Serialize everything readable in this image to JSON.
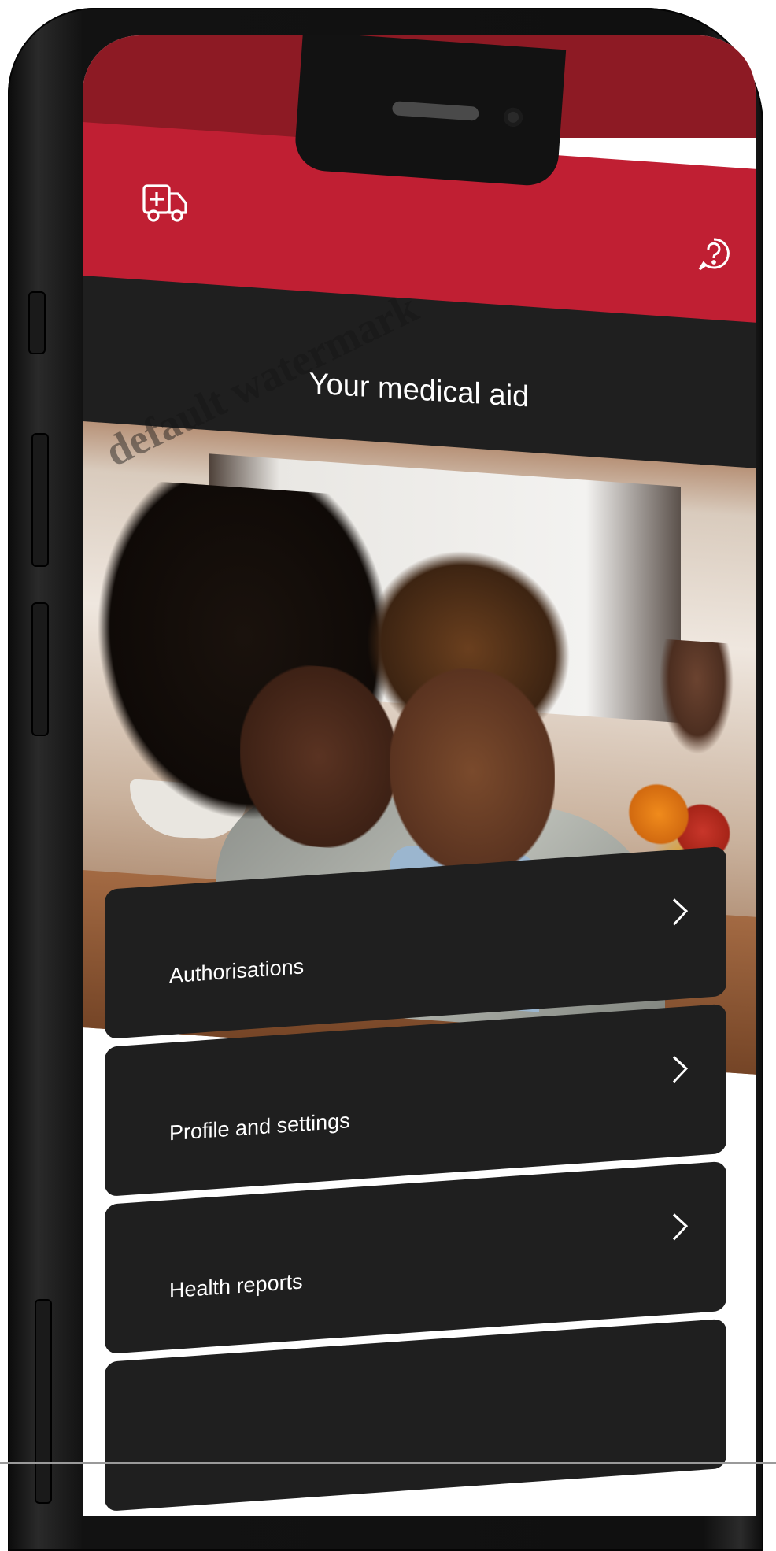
{
  "header": {
    "ambulance_icon": "ambulance-icon",
    "help_icon": "question-circle-icon"
  },
  "page": {
    "title": "Your medical aid"
  },
  "hero": {
    "image": "mother-and-daughter-photo"
  },
  "menu": [
    {
      "label": "Authorisations",
      "icon": "chevron-right-icon"
    },
    {
      "label": "Profile and settings",
      "icon": "chevron-right-icon"
    },
    {
      "label": "Health reports",
      "icon": "chevron-right-icon"
    }
  ],
  "watermark": "default watermark",
  "colors": {
    "brand_red": "#c01f33",
    "status_red": "#8d1a24",
    "card_dark": "#1f1f1f"
  }
}
